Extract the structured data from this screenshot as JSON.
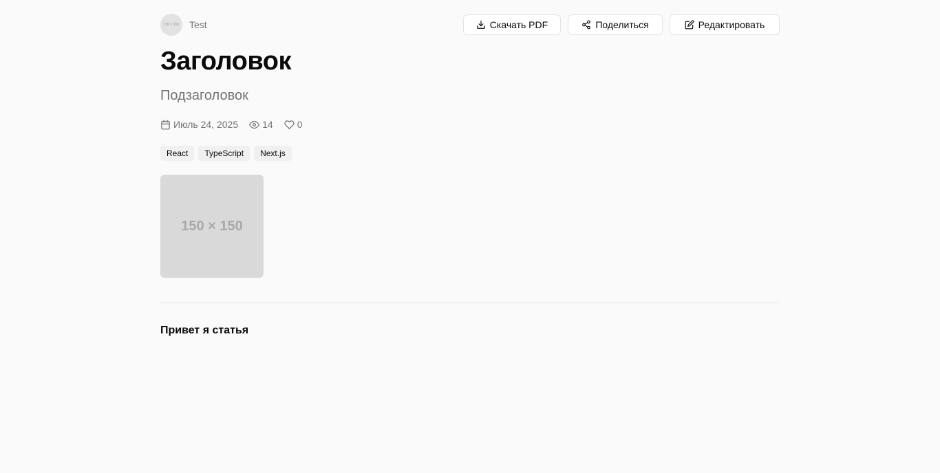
{
  "author": {
    "name": "Test",
    "avatar_text": "150 × 150"
  },
  "actions": {
    "download_pdf": "Скачать PDF",
    "share": "Поделиться",
    "edit": "Редактировать"
  },
  "article": {
    "title": "Заголовок",
    "subtitle": "Подзаголовок",
    "date": "Июль 24, 2025",
    "views": "14",
    "likes": "0",
    "tags": [
      "React",
      "TypeScript",
      "Next.js"
    ],
    "cover_placeholder": "150 × 150",
    "content": "Привет я статья"
  },
  "colors": {
    "background": "#fafafa",
    "muted_text": "#737373",
    "border": "#e4e4e7",
    "tag_bg": "#f0f0f0",
    "placeholder_bg": "#d9d9d9"
  }
}
